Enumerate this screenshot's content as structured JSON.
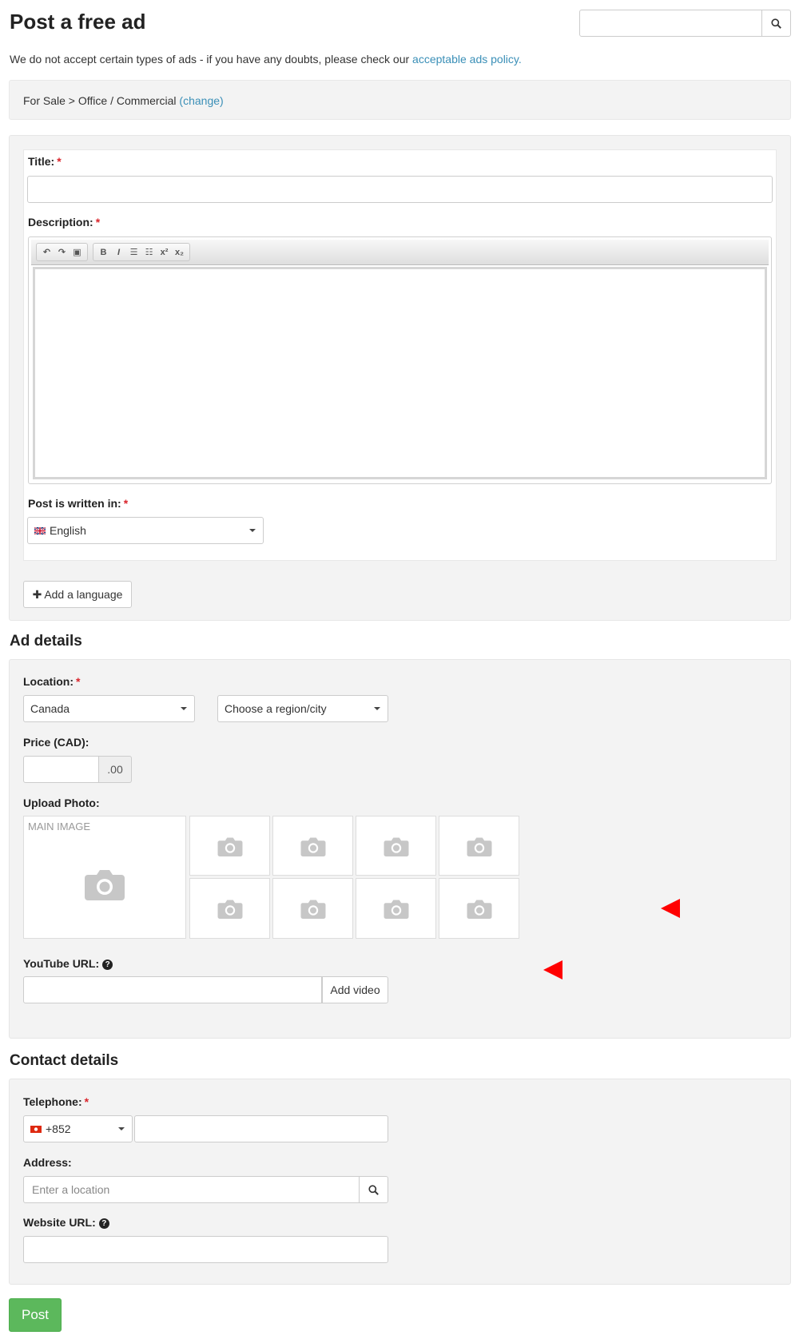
{
  "header": {
    "title": "Post a free ad",
    "search_placeholder": ""
  },
  "intro": {
    "text": "We do not accept certain types of ads - if you have any doubts, please check our",
    "link": "acceptable ads policy."
  },
  "breadcrumb": {
    "path": "For Sale > Office / Commercial",
    "change_link": "(change)"
  },
  "post_form": {
    "title_label": "Title:",
    "description_label": "Description:",
    "language_label": "Post is written in:",
    "language_value": "English",
    "add_language": "Add a language",
    "required_mark": "*"
  },
  "ad_details": {
    "heading": "Ad details",
    "location_label": "Location:",
    "country": "Canada",
    "region_placeholder": "Choose a region/city",
    "price_label": "Price (CAD):",
    "price_suffix": ".00",
    "upload_label": "Upload Photo:",
    "main_image": "MAIN IMAGE",
    "youtube_label": "YouTube URL:",
    "add_video": "Add video"
  },
  "contact": {
    "heading": "Contact details",
    "telephone_label": "Telephone:",
    "country_code": "+852",
    "address_label": "Address:",
    "address_placeholder": "Enter a location",
    "website_label": "Website URL:"
  },
  "post_button": "Post",
  "colors": {
    "link": "#3a8fb7",
    "required": "#d9242b",
    "post_button": "#5cb85c",
    "annotation": "#ff0000"
  },
  "icons": [
    "search-icon",
    "undo-icon",
    "redo-icon",
    "paste-icon",
    "bold-icon",
    "italic-icon",
    "bulleted-list-icon",
    "numbered-list-icon",
    "superscript-icon",
    "subscript-icon",
    "uk-flag-icon",
    "plus-icon",
    "camera-icon",
    "help-icon",
    "hong-kong-flag-icon",
    "red-arrow-marker"
  ]
}
